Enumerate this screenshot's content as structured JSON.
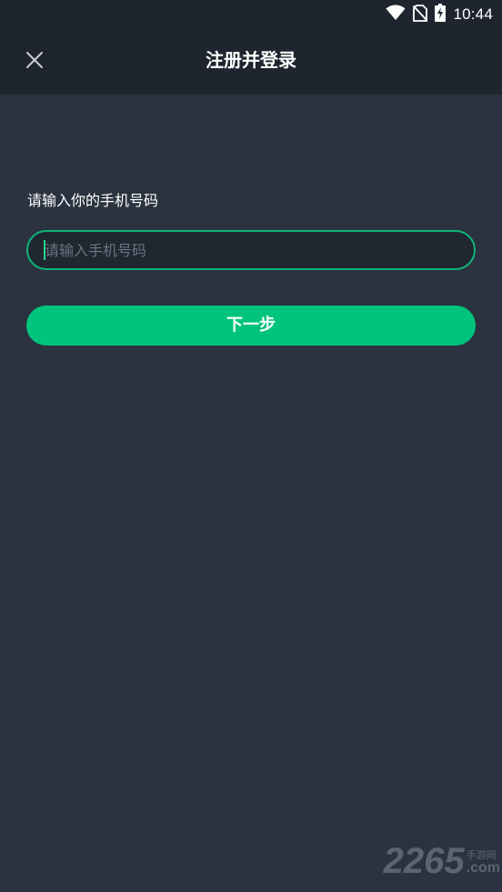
{
  "status_bar": {
    "time": "10:44",
    "icons": [
      "wifi-icon",
      "no-sim-icon",
      "battery-charging-icon"
    ]
  },
  "header": {
    "title": "注册并登录",
    "close_icon": "close-icon"
  },
  "form": {
    "label": "请输入你的手机号码",
    "phone_placeholder": "请输入手机号码",
    "phone_value": "",
    "next_label": "下一步"
  },
  "watermark": {
    "number": "2265",
    "brand_cn": "手游网",
    "domain": ".com"
  },
  "colors": {
    "background": "#2a333f",
    "header_bg": "#1e252e",
    "accent": "#00c47e",
    "input_border": "#0fb577"
  }
}
